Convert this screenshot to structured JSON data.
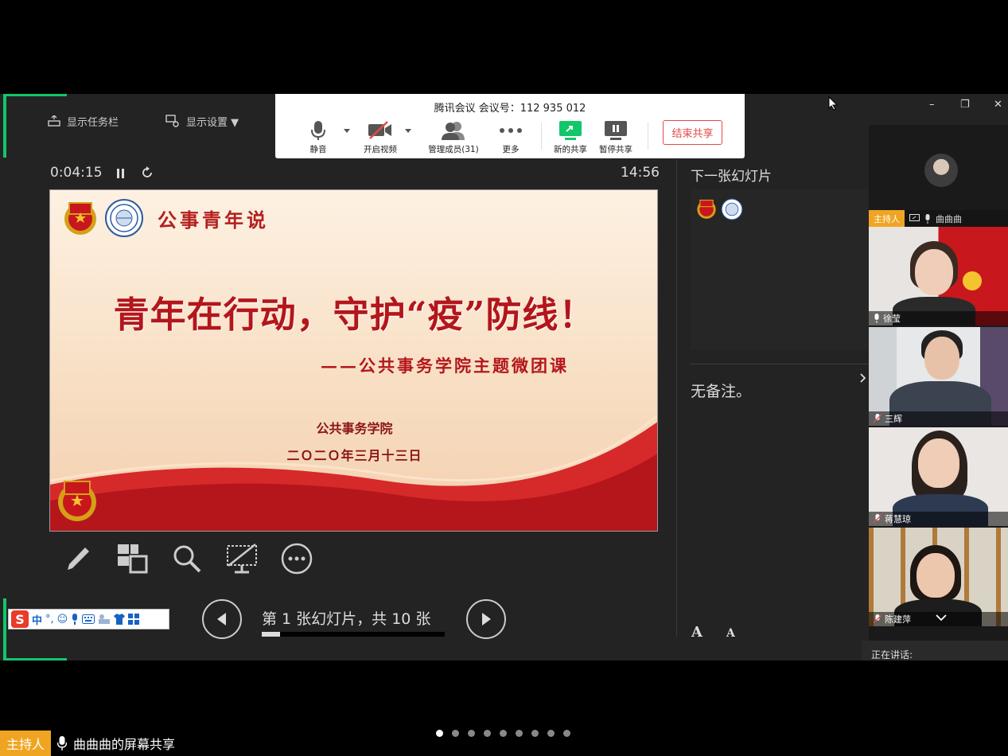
{
  "presenter_toolbar": {
    "show_taskbar": "显示任务栏",
    "display_settings": "显示设置 ▼"
  },
  "meeting_bar": {
    "title": "腾讯会议 会议号：112 935 012",
    "mute": "静音",
    "video": "开启视频",
    "manage": "管理成员(31)",
    "more": "更多",
    "new_share": "新的共享",
    "pause_share": "暂停共享",
    "end_share": "结束共享"
  },
  "timer": "0:04:15",
  "clock": "14:56",
  "slide": {
    "header": "公事青年说",
    "title": "青年在行动，守护“疫”防线！",
    "subtitle": "——公共事务学院主题微团课",
    "org": "公共事务学院",
    "date": "二Ｏ二Ｏ年三月十三日"
  },
  "ime": {
    "mode": "中"
  },
  "slide_nav": {
    "counter": "第 1 张幻灯片，共 10 张",
    "current": 1,
    "total": 10
  },
  "next_slide_label": "下一张幻灯片",
  "notes": "无备注。",
  "font_buttons": {
    "increase": "A",
    "decrease": "A"
  },
  "window_controls": {
    "minimize": "–",
    "restore": "❐",
    "close": "✕"
  },
  "participants": {
    "host_tag": "主持人",
    "host_name": "曲曲曲",
    "tiles": [
      {
        "name": "徐莹"
      },
      {
        "name": "三辉"
      },
      {
        "name": "蒋慧琼"
      },
      {
        "name": "陈建萍"
      }
    ]
  },
  "speaking_now": "正在讲话:",
  "bottom": {
    "host_tag": "主持人",
    "share_text": "曲曲曲的屏幕共享"
  },
  "page_dots": {
    "count": 9,
    "active": 0
  },
  "colors": {
    "accent_green": "#12c66a",
    "host_orange": "#f0a522",
    "end_share_red": "#e34a4a",
    "slide_red": "#b3161b"
  }
}
